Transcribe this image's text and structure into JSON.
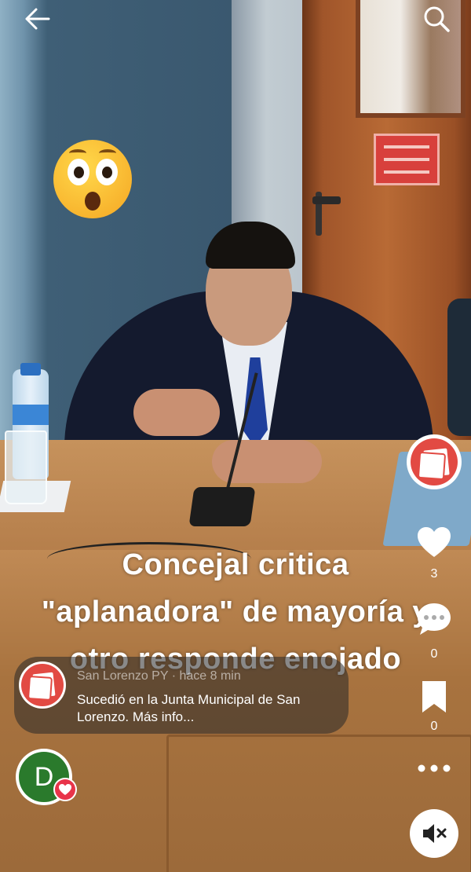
{
  "video": {
    "caption_line1": "Concejal critica",
    "caption_line2": "\"aplanadora\" de mayoría y",
    "caption_line3": "otro responde enojado"
  },
  "top_bar": {
    "back_icon": "arrow-left-icon",
    "search_icon": "search-icon"
  },
  "actions": {
    "likes": "3",
    "comments": "0",
    "saves": "0"
  },
  "post": {
    "author": "San Lorenzo PY",
    "separator": "·",
    "time": "hace 8 min",
    "description": "Sucedió en la Junta Municipal de San Lorenzo. Más info..."
  },
  "user": {
    "initial": "D"
  },
  "colors": {
    "brand_red": "#e24a43",
    "like_badge": "#e8344a",
    "user_avatar": "#2a7a2c"
  }
}
